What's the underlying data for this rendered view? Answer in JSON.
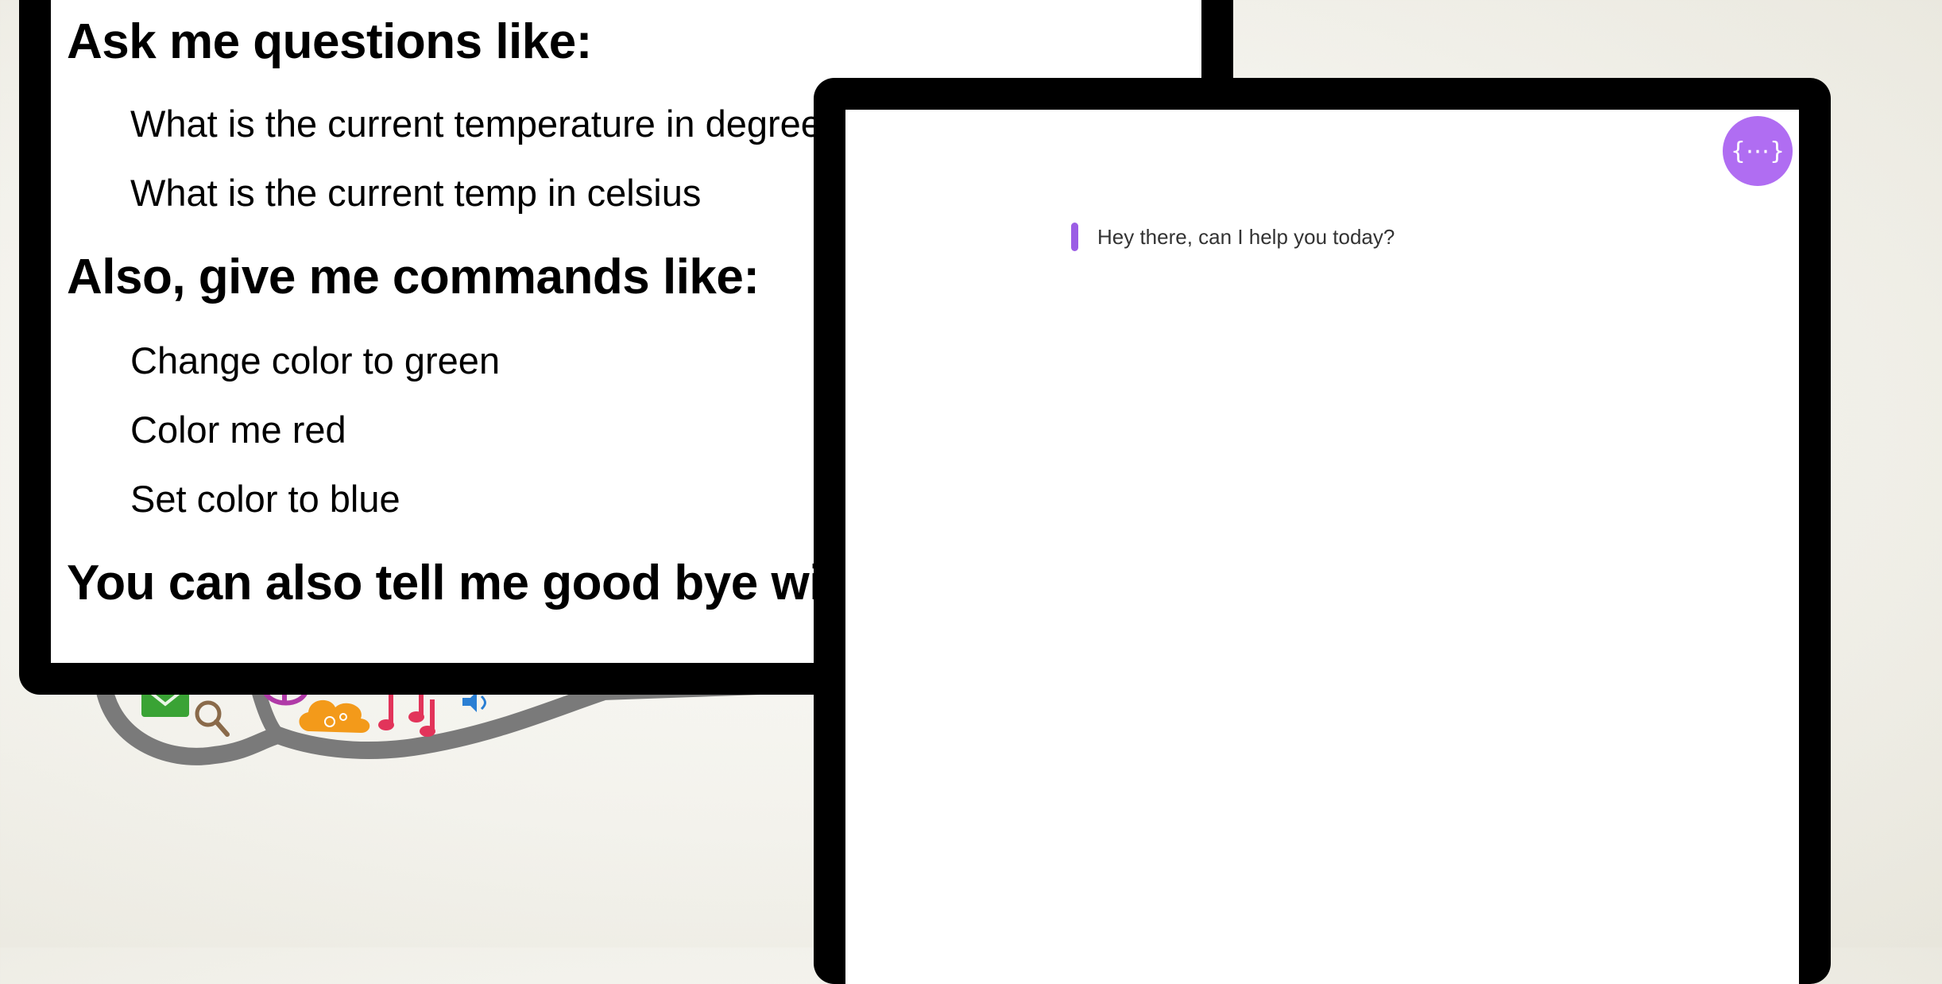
{
  "instructions": {
    "heading_questions": "Ask me questions like:",
    "questions": [
      "What is the current temperature in degrees",
      "What is the current temp in celsius"
    ],
    "heading_commands": "Also, give me commands like:",
    "commands": [
      "Change color to green",
      "Color me red",
      "Set color to blue"
    ],
    "heading_goodbye": "You can also tell me good bye with"
  },
  "chat": {
    "avatar_glyph": "{⋯}",
    "avatar_icon": "curly-braces-bot-icon",
    "messages": [
      {
        "text": "Hey there, can I help you today?"
      }
    ]
  },
  "colors": {
    "accent": "#b06df2",
    "message_bar": "#9b5de5",
    "frame": "#000000"
  }
}
